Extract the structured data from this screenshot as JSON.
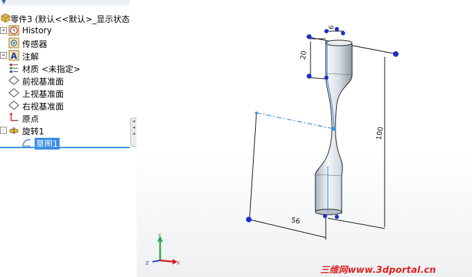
{
  "tree": {
    "root_label": "零件3 (默认<<默认>_显示状态",
    "items": [
      {
        "label": "History",
        "icon": "history-clock-icon",
        "expander": "+"
      },
      {
        "label": "传感器",
        "icon": "sensor-icon",
        "expander": ""
      },
      {
        "label": "注解",
        "icon": "annotation-icon",
        "expander": "+"
      },
      {
        "label": "材质 <未指定>",
        "icon": "material-icon",
        "expander": ""
      },
      {
        "label": "前视基准面",
        "icon": "plane-icon",
        "expander": ""
      },
      {
        "label": "上视基准面",
        "icon": "plane-icon",
        "expander": ""
      },
      {
        "label": "右视基准面",
        "icon": "plane-icon",
        "expander": ""
      },
      {
        "label": "原点",
        "icon": "origin-icon",
        "expander": ""
      },
      {
        "label": "旋转1",
        "icon": "revolve-icon",
        "expander": "-"
      },
      {
        "label": "草图1",
        "icon": "sketch-icon",
        "expander": ""
      }
    ]
  },
  "dimensions": {
    "top_diameter": "6",
    "top_height": "20",
    "total_height": "100",
    "bottom_width": "56"
  },
  "axes": {
    "y": "Y",
    "z": "Z",
    "x": "X"
  },
  "colors": {
    "accent": "#3a8ee6",
    "dim_blue": "#1a2fd0",
    "watermark": "#e02020"
  },
  "watermark": "三维网www.3dportal.cn"
}
